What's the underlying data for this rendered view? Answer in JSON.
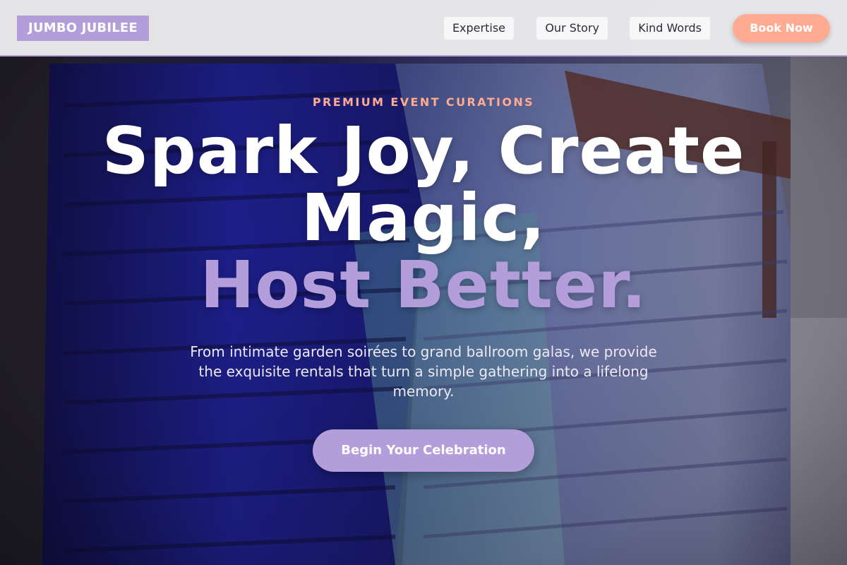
{
  "header": {
    "logo": "JUMBO JUBILEE",
    "nav": [
      {
        "label": "Expertise"
      },
      {
        "label": "Our Story"
      },
      {
        "label": "Kind Words"
      }
    ],
    "book_button": "Book Now"
  },
  "hero": {
    "eyebrow": "PREMIUM EVENT CURATIONS",
    "headline_line1": "Spark Joy, Create",
    "headline_line2": "Magic,",
    "headline_accent": "Host Better.",
    "subtext": "From intimate garden soirées to grand ballroom galas, we provide the exquisite rentals that turn a simple gathering into a lifelong memory.",
    "cta": "Begin Your Celebration",
    "background_image": "stacked-plastic-chairs-photo"
  },
  "colors": {
    "accent": "#b39ddb",
    "cta_coral": "#ffab91",
    "header_bg": "#ececee"
  }
}
